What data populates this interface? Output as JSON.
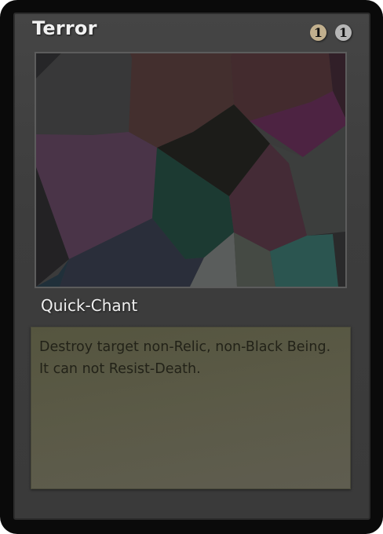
{
  "card": {
    "name": "Terror",
    "type_line": "Quick-Chant",
    "rules_text": "Destroy target non-Relic, non-Black Being. It can not Resist-Death.",
    "mana_cost": [
      {
        "symbol": "1",
        "kind": "generic",
        "color": "#c2b08e"
      },
      {
        "symbol": "1",
        "kind": "black",
        "color": "#b6b6b6"
      }
    ],
    "frame_color": "#3d3d3d",
    "text_box_color": "#5a5946",
    "art": "abstract-voronoi-polygons"
  }
}
